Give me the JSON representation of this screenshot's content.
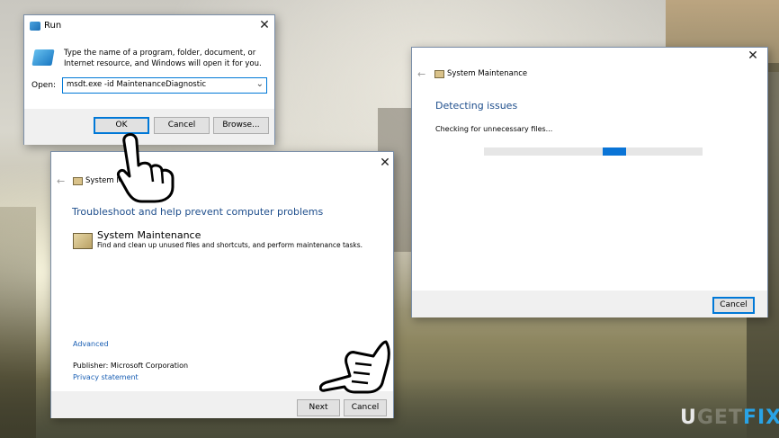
{
  "run_dialog": {
    "title": "Run",
    "description": "Type the name of a program, folder, document, or Internet resource, and Windows will open it for you.",
    "open_label": "Open:",
    "command_value": "msdt.exe -id MaintenanceDiagnostic",
    "ok_label": "OK",
    "cancel_label": "Cancel",
    "browse_label": "Browse..."
  },
  "troubleshoot_wizard": {
    "title": "System Maintenance",
    "heading": "Troubleshoot and help prevent computer problems",
    "item_name": "System Maintenance",
    "item_description": "Find and clean up unused files and shortcuts, and perform maintenance tasks.",
    "advanced_link": "Advanced",
    "publisher": "Publisher:  Microsoft Corporation",
    "privacy_link": "Privacy statement",
    "next_label": "Next",
    "cancel_label": "Cancel"
  },
  "detecting_window": {
    "title": "System Maintenance",
    "heading": "Detecting issues",
    "status": "Checking for unnecessary files...",
    "cancel_label": "Cancel"
  },
  "icons": {
    "close": "close-icon",
    "back": "back-arrow-icon",
    "dropdown": "chevron-down-icon",
    "pointer": "hand-pointer-icon"
  },
  "colors": {
    "accent": "#0078d7",
    "heading": "#1e4e8c",
    "link": "#1a5fb4",
    "progress": "#0a74d6",
    "logo_fix": "#29a3e6"
  },
  "logo": {
    "part1": "U",
    "part2": "GET",
    "part3": "FIX"
  }
}
